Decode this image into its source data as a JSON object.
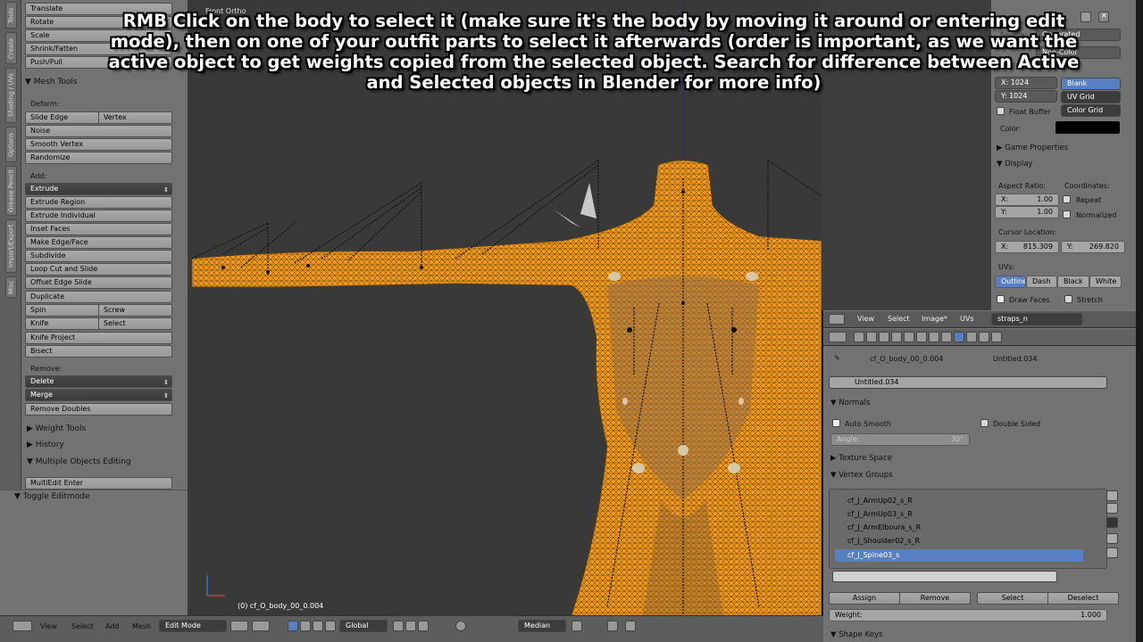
{
  "overlay_text": "RMB Click on the body to select it (make sure it's the body by moving it around or entering edit mode), then on one of your outfit parts to select it afterwards (order is important, as we want the active object to get weights copied from the selected object. Search for difference between Active and Selected objects in Blender for more info)",
  "vtabs": [
    "Tools",
    "Create",
    "Shading / UVs",
    "Options",
    "Grease Pencil",
    "Import/Export",
    "Misc"
  ],
  "toolshelf": {
    "transform_buttons": [
      "Translate",
      "Rotate",
      "Scale",
      "Shrink/Fatten",
      "Push/Pull"
    ],
    "mesh_tools_header": "Mesh Tools",
    "deform_label": "Deform:",
    "slide_edge": "Slide Edge",
    "vertex": "Vertex",
    "noise": "Noise",
    "smooth_vertex": "Smooth Vertex",
    "randomize": "Randomize",
    "add_label": "Add:",
    "extrude": "Extrude",
    "add_buttons": [
      "Extrude Region",
      "Extrude Individual",
      "Inset Faces",
      "Make Edge/Face",
      "Subdivide",
      "Loop Cut and Slide",
      "Offset Edge Slide",
      "Duplicate"
    ],
    "spin": "Spin",
    "screw": "Screw",
    "knife": "Knife",
    "select": "Select",
    "knife_project": "Knife Project",
    "bisect": "Bisect",
    "remove_label": "Remove:",
    "delete": "Delete",
    "merge": "Merge",
    "remove_doubles": "Remove Doubles",
    "weight_tools": "Weight Tools",
    "history": "History",
    "multi_obj": "Multiple Objects Editing",
    "multiedit_enter": "MultiEdit Enter",
    "toggle_editmode": "Toggle Editmode"
  },
  "viewport": {
    "view_label": "Front Ortho",
    "object_info": "(0) cf_O_body_00_0.004"
  },
  "image_panel": {
    "source_label": "Source:",
    "source_value": "Generated",
    "colorspace": "Non-Color",
    "render_label": "Render",
    "x_label": "X:",
    "x_value": "1024",
    "y_label": "Y:",
    "y_value": "1024",
    "gen_types": [
      "Blank",
      "UV Grid",
      "Color Grid"
    ],
    "float_buffer": "Float Buffer",
    "color_label": "Color:",
    "game_props": "Game Properties",
    "display": "Display",
    "aspect_ratio": "Aspect Ratio:",
    "coordinates": "Coordinates:",
    "ax_label": "X:",
    "ax_value": "1.00",
    "ay_label": "Y:",
    "ay_value": "1.00",
    "repeat": "Repeat",
    "normalized": "Normalized",
    "cursor_location": "Cursor Location:",
    "cx_label": "X:",
    "cx_value": "815.309",
    "cy_label": "Y:",
    "cy_value": "269.820",
    "uvs_label": "UVs:",
    "uv_styles": [
      "Outline",
      "Dash",
      "Black",
      "White"
    ],
    "draw_faces": "Draw Faces",
    "stretch": "Stretch"
  },
  "props": {
    "menu": [
      "View",
      "Select",
      "Image*",
      "UVs"
    ],
    "image_name": "straps_n",
    "breadcrumb_obj": "cf_O_body_00_0.004",
    "breadcrumb_mesh": "Untitled.034",
    "mesh_name": "Untitled.034",
    "normals": "Normals",
    "auto_smooth": "Auto Smooth",
    "double_sided": "Double Sided",
    "angle_label": "Angle:",
    "angle_value": "30°",
    "texture_space": "Texture Space",
    "vertex_groups": "Vertex Groups",
    "groups": [
      "cf_J_ArmUp02_s_R",
      "cf_J_ArmUp03_s_R",
      "cf_J_ArmElboura_s_R",
      "cf_J_Shoulder02_s_R",
      "cf_J_Spine03_s"
    ],
    "assign": "Assign",
    "remove": "Remove",
    "select": "Select",
    "deselect": "Deselect",
    "weight_label": "Weight:",
    "weight_value": "1.000",
    "shape_keys": "Shape Keys"
  },
  "bottombar": {
    "menu": [
      "View",
      "Select",
      "Add",
      "Mesh"
    ],
    "mode": "Edit Mode",
    "orientation": "Global",
    "pivot": "Median"
  }
}
